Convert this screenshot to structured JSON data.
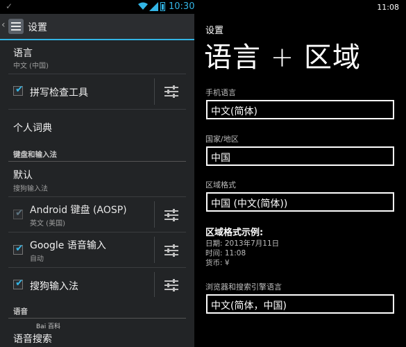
{
  "android": {
    "status_bar": {
      "time": "10:30",
      "icons": [
        "check-icon",
        "wifi-icon",
        "signal-icon",
        "battery-icon"
      ],
      "accent": "#33b5e5"
    },
    "action_bar": {
      "title": "设置",
      "icon": "settings-sliders-icon"
    },
    "items": {
      "language": {
        "title": "语言",
        "subtitle": "中文 (中国)"
      },
      "spell_checker": {
        "title": "拼写检查工具",
        "checked": true
      },
      "personal_dictionary": {
        "title": "个人词典"
      },
      "keyboard_category": "键盘和输入法",
      "default": {
        "title": "默认",
        "subtitle": "搜狗输入法"
      },
      "aosp": {
        "title": "Android 键盘 (AOSP)",
        "subtitle": "英文 (美国)",
        "checked": true,
        "disabled": true
      },
      "google_voice": {
        "title": "Google 语音输入",
        "subtitle": "自动",
        "checked": true
      },
      "sogou": {
        "title": "搜狗输入法",
        "checked": true
      },
      "voice_category": "语音",
      "voice_search": {
        "title": "语音搜索"
      }
    },
    "watermark": "Bai 百科"
  },
  "wp": {
    "time": "11:08",
    "header_small": "设置",
    "header_big": "语言 + 区域",
    "phone_language": {
      "label": "手机语言",
      "value": "中文(简体)"
    },
    "country": {
      "label": "国家/地区",
      "value": "中国"
    },
    "region_format": {
      "label": "区域格式",
      "value": "中国 (中文(简体))"
    },
    "sample": {
      "title": "区域格式示例:",
      "date": "日期: 2013年7月11日",
      "time": "时间: 11:08",
      "currency": "货币: ¥"
    },
    "browser_language": {
      "label": "浏览器和搜索引擎语言",
      "value": "中文(简体，中国)"
    }
  }
}
